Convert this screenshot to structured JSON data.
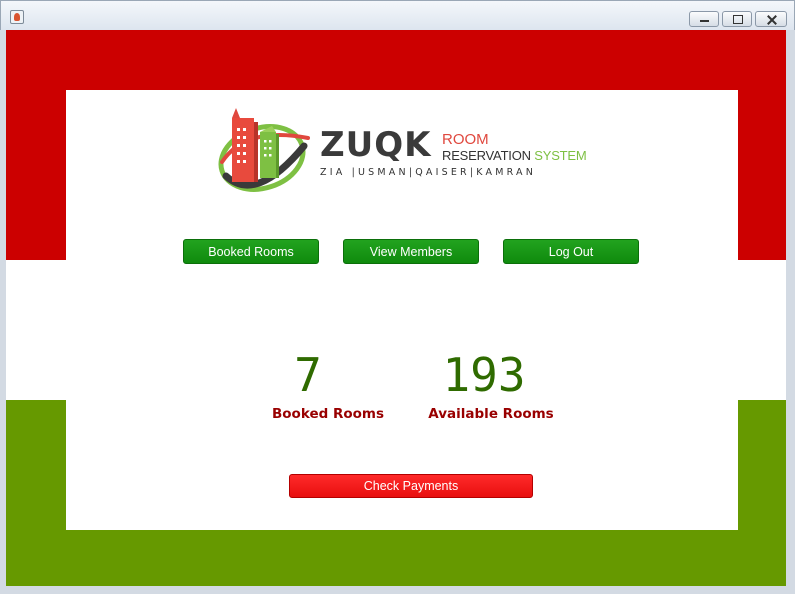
{
  "window": {
    "icon": "java-cup-icon",
    "controls": [
      "minimize",
      "maximize",
      "close"
    ]
  },
  "logo": {
    "word": "ZUQK",
    "line1": "ROOM",
    "line2_prefix": "RESERVATION",
    "line2_suffix": "SYSTEM",
    "names": "ZIA |USMAN|QAISER|KAMRAN",
    "colors": {
      "red": "#e0483e",
      "green": "#7ec043",
      "dark": "#3a3a3a"
    }
  },
  "nav": {
    "booked_rooms": "Booked Rooms",
    "view_members": "View Members",
    "log_out": "Log Out"
  },
  "stats": {
    "booked_count": "7",
    "booked_label": "Booked Rooms",
    "available_count": "193",
    "available_label": "Available Rooms"
  },
  "actions": {
    "check_payments": "Check Payments"
  },
  "colors": {
    "band_red": "#cc0000",
    "band_green": "#669900",
    "button_green": "#0f8a0d",
    "button_red": "#e80f0f",
    "stat_number": "#2f6b00",
    "stat_label": "#990000"
  }
}
